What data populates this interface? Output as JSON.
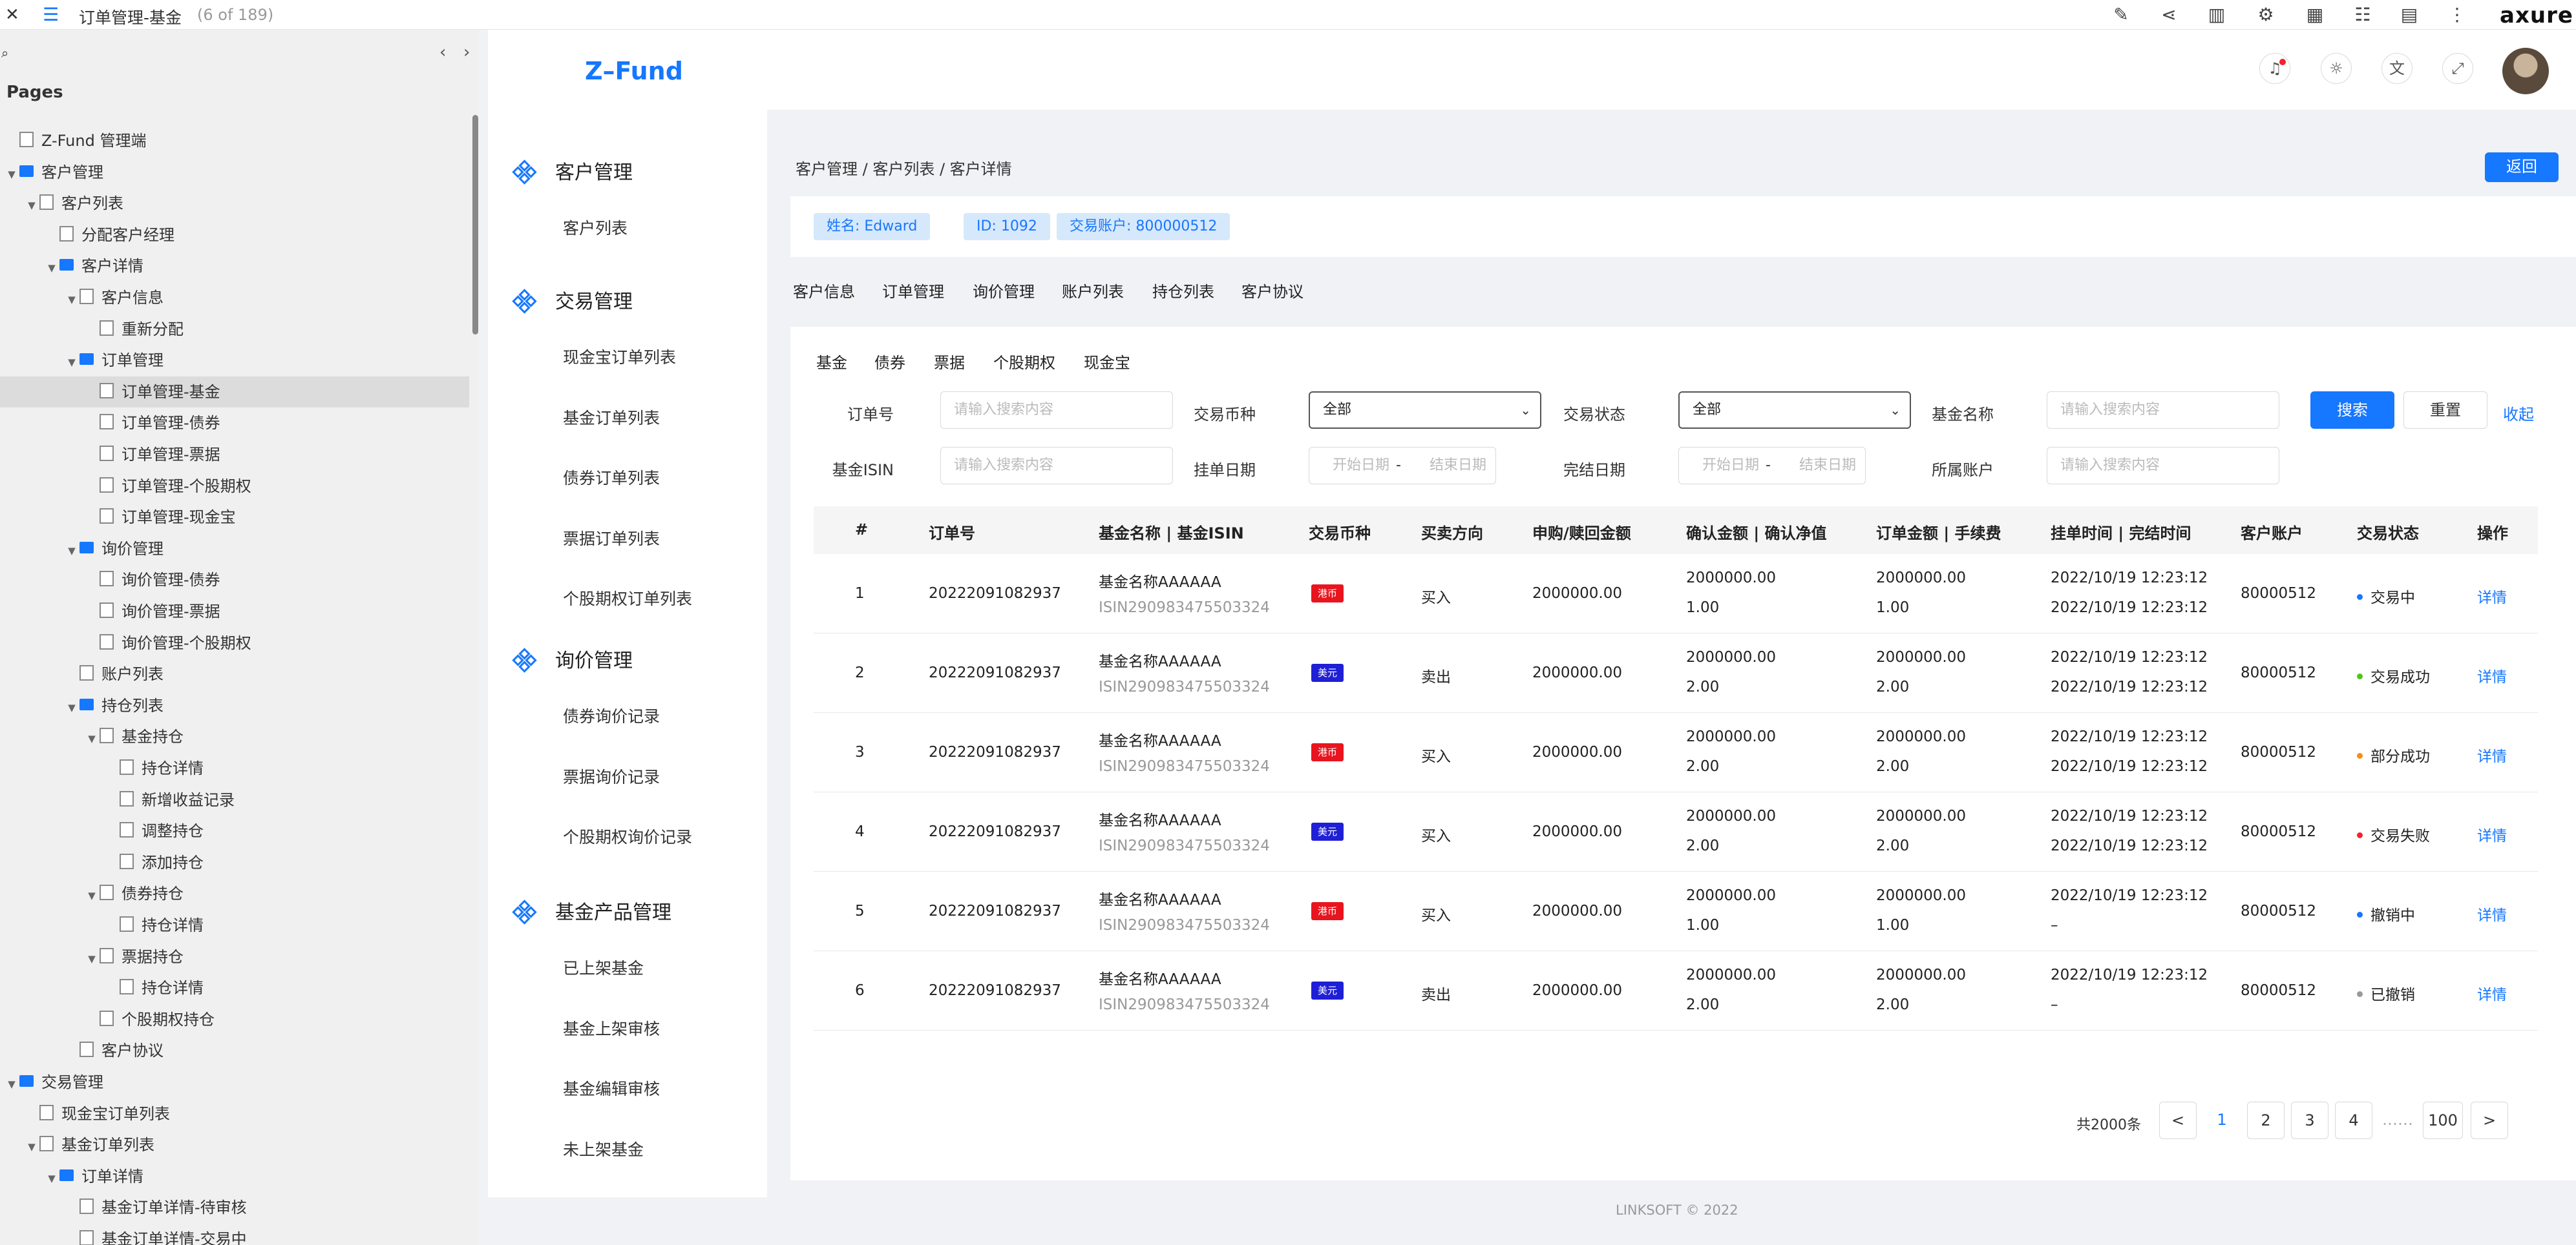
{
  "axure_toolbar": {
    "close": "✕",
    "page_title": "订单管理-基金",
    "page_count": "(6 of 189)",
    "logo": "axure",
    "icons": [
      "edit-icon",
      "share-icon",
      "map-icon",
      "settings-icon",
      "grid-icon",
      "list-icon",
      "notes-icon",
      "more-icon"
    ]
  },
  "pages_panel": {
    "heading": "Pages",
    "items": [
      {
        "label": "Z-Fund 管理端",
        "level": 0,
        "type": "page",
        "caret": ""
      },
      {
        "label": "客户管理",
        "level": 0,
        "type": "folder",
        "caret": "▼"
      },
      {
        "label": "客户列表",
        "level": 1,
        "type": "page",
        "caret": "▼"
      },
      {
        "label": "分配客户经理",
        "level": 2,
        "type": "page",
        "caret": ""
      },
      {
        "label": "客户详情",
        "level": 2,
        "type": "folder",
        "caret": "▼"
      },
      {
        "label": "客户信息",
        "level": 3,
        "type": "page",
        "caret": "▼"
      },
      {
        "label": "重新分配",
        "level": 4,
        "type": "page",
        "caret": ""
      },
      {
        "label": "订单管理",
        "level": 3,
        "type": "folder",
        "caret": "▼"
      },
      {
        "label": "订单管理-基金",
        "level": 4,
        "type": "page",
        "caret": "",
        "selected": true
      },
      {
        "label": "订单管理-债券",
        "level": 4,
        "type": "page",
        "caret": ""
      },
      {
        "label": "订单管理-票据",
        "level": 4,
        "type": "page",
        "caret": ""
      },
      {
        "label": "订单管理-个股期权",
        "level": 4,
        "type": "page",
        "caret": ""
      },
      {
        "label": "订单管理-现金宝",
        "level": 4,
        "type": "page",
        "caret": ""
      },
      {
        "label": "询价管理",
        "level": 3,
        "type": "folder",
        "caret": "▼"
      },
      {
        "label": "询价管理-债券",
        "level": 4,
        "type": "page",
        "caret": ""
      },
      {
        "label": "询价管理-票据",
        "level": 4,
        "type": "page",
        "caret": ""
      },
      {
        "label": "询价管理-个股期权",
        "level": 4,
        "type": "page",
        "caret": ""
      },
      {
        "label": "账户列表",
        "level": 3,
        "type": "page",
        "caret": ""
      },
      {
        "label": "持仓列表",
        "level": 3,
        "type": "folder",
        "caret": "▼"
      },
      {
        "label": "基金持仓",
        "level": 4,
        "type": "page",
        "caret": "▼"
      },
      {
        "label": "持仓详情",
        "level": 5,
        "type": "page",
        "caret": ""
      },
      {
        "label": "新增收益记录",
        "level": 5,
        "type": "page",
        "caret": ""
      },
      {
        "label": "调整持仓",
        "level": 5,
        "type": "page",
        "caret": ""
      },
      {
        "label": "添加持仓",
        "level": 5,
        "type": "page",
        "caret": ""
      },
      {
        "label": "债券持仓",
        "level": 4,
        "type": "page",
        "caret": "▼"
      },
      {
        "label": "持仓详情",
        "level": 5,
        "type": "page",
        "caret": ""
      },
      {
        "label": "票据持仓",
        "level": 4,
        "type": "page",
        "caret": "▼"
      },
      {
        "label": "持仓详情",
        "level": 5,
        "type": "page",
        "caret": ""
      },
      {
        "label": "个股期权持仓",
        "level": 4,
        "type": "page",
        "caret": ""
      },
      {
        "label": "客户协议",
        "level": 3,
        "type": "page",
        "caret": ""
      },
      {
        "label": "交易管理",
        "level": 0,
        "type": "folder",
        "caret": "▼"
      },
      {
        "label": "现金宝订单列表",
        "level": 1,
        "type": "page",
        "caret": ""
      },
      {
        "label": "基金订单列表",
        "level": 1,
        "type": "page",
        "caret": "▼"
      },
      {
        "label": "订单详情",
        "level": 2,
        "type": "folder",
        "caret": "▼"
      },
      {
        "label": "基金订单详情-待审核",
        "level": 3,
        "type": "page",
        "caret": ""
      },
      {
        "label": "基金订单详情-交易中",
        "level": 3,
        "type": "page",
        "caret": ""
      }
    ]
  },
  "app": {
    "brand": "Z–Fund",
    "header_icons": [
      "bell-icon",
      "theme-icon",
      "translate-icon",
      "fullscreen-icon"
    ],
    "menu": [
      {
        "group": "客户管理",
        "items": [
          "客户列表"
        ]
      },
      {
        "group": "交易管理",
        "items": [
          "现金宝订单列表",
          "基金订单列表",
          "债券订单列表",
          "票据订单列表",
          "个股期权订单列表"
        ]
      },
      {
        "group": "询价管理",
        "items": [
          "债券询价记录",
          "票据询价记录",
          "个股期权询价记录"
        ]
      },
      {
        "group": "基金产品管理",
        "items": [
          "已上架基金",
          "基金上架审核",
          "基金编辑审核",
          "未上架基金"
        ]
      }
    ],
    "breadcrumb": "客户管理 / 客户列表 / 客户详情",
    "back_label": "返回",
    "tags": [
      "姓名: Edward",
      "ID: 1092",
      "交易账户: 800000512"
    ],
    "tabs": [
      "客户信息",
      "订单管理",
      "询价管理",
      "账户列表",
      "持仓列表",
      "客户协议"
    ],
    "subtabs": [
      "基金",
      "债券",
      "票据",
      "个股期权",
      "现金宝"
    ],
    "filters": {
      "order_no_label": "订单号",
      "order_no_placeholder": "请输入搜索内容",
      "currency_label": "交易币种",
      "currency_value": "全部",
      "status_label": "交易状态",
      "status_value": "全部",
      "fund_name_label": "基金名称",
      "fund_name_placeholder": "请输入搜索内容",
      "isin_label": "基金ISIN",
      "isin_placeholder": "请输入搜索内容",
      "order_date_label": "挂单日期",
      "start_placeholder": "开始日期",
      "end_placeholder": "结束日期",
      "range_sep": "-",
      "done_date_label": "完结日期",
      "account_label": "所属账户",
      "account_placeholder": "请输入搜索内容",
      "search_label": "搜索",
      "reset_label": "重置",
      "collapse_label": "收起"
    },
    "table": {
      "columns": [
        "#",
        "订单号",
        "基金名称 | 基金ISIN",
        "交易币种",
        "买卖方向",
        "申购/赎回金额",
        "确认金额 | 确认净值",
        "订单金额 | 手续费",
        "挂单时间 | 完结时间",
        "客户账户",
        "交易状态",
        "操作"
      ],
      "rows": [
        {
          "idx": "1",
          "order_no": "20222091082937",
          "fund_name": "基金名称AAAAAA",
          "isin": "ISIN290983475503324",
          "currency": "港币",
          "currency_color": "#e8141e",
          "direction": "买入",
          "amount": "2000000.00",
          "confirm_amount": "2000000.00",
          "confirm_nav": "1.00",
          "order_amount": "2000000.00",
          "fee": "1.00",
          "order_time": "2022/10/19 12:23:12",
          "done_time": "2022/10/19 12:23:12",
          "account": "80000512",
          "status": "交易中",
          "status_color": "#1677ff",
          "action": "详情"
        },
        {
          "idx": "2",
          "order_no": "20222091082937",
          "fund_name": "基金名称AAAAAA",
          "isin": "ISIN290983475503324",
          "currency": "美元",
          "currency_color": "#1f1fd6",
          "direction": "卖出",
          "amount": "2000000.00",
          "confirm_amount": "2000000.00",
          "confirm_nav": "2.00",
          "order_amount": "2000000.00",
          "fee": "2.00",
          "order_time": "2022/10/19 12:23:12",
          "done_time": "2022/10/19 12:23:12",
          "account": "80000512",
          "status": "交易成功",
          "status_color": "#52c41a",
          "action": "详情"
        },
        {
          "idx": "3",
          "order_no": "20222091082937",
          "fund_name": "基金名称AAAAAA",
          "isin": "ISIN290983475503324",
          "currency": "港币",
          "currency_color": "#e8141e",
          "direction": "买入",
          "amount": "2000000.00",
          "confirm_amount": "2000000.00",
          "confirm_nav": "2.00",
          "order_amount": "2000000.00",
          "fee": "2.00",
          "order_time": "2022/10/19 12:23:12",
          "done_time": "2022/10/19 12:23:12",
          "account": "80000512",
          "status": "部分成功",
          "status_color": "#fa8c16",
          "action": "详情"
        },
        {
          "idx": "4",
          "order_no": "20222091082937",
          "fund_name": "基金名称AAAAAA",
          "isin": "ISIN290983475503324",
          "currency": "美元",
          "currency_color": "#1f1fd6",
          "direction": "买入",
          "amount": "2000000.00",
          "confirm_amount": "2000000.00",
          "confirm_nav": "2.00",
          "order_amount": "2000000.00",
          "fee": "2.00",
          "order_time": "2022/10/19 12:23:12",
          "done_time": "2022/10/19 12:23:12",
          "account": "80000512",
          "status": "交易失败",
          "status_color": "#f5222d",
          "action": "详情"
        },
        {
          "idx": "5",
          "order_no": "20222091082937",
          "fund_name": "基金名称AAAAAA",
          "isin": "ISIN290983475503324",
          "currency": "港币",
          "currency_color": "#e8141e",
          "direction": "买入",
          "amount": "2000000.00",
          "confirm_amount": "2000000.00",
          "confirm_nav": "1.00",
          "order_amount": "2000000.00",
          "fee": "1.00",
          "order_time": "2022/10/19 12:23:12",
          "done_time": "–",
          "account": "80000512",
          "status": "撤销中",
          "status_color": "#1677ff",
          "action": "详情"
        },
        {
          "idx": "6",
          "order_no": "20222091082937",
          "fund_name": "基金名称AAAAAA",
          "isin": "ISIN290983475503324",
          "currency": "美元",
          "currency_color": "#1f1fd6",
          "direction": "卖出",
          "amount": "2000000.00",
          "confirm_amount": "2000000.00",
          "confirm_nav": "2.00",
          "order_amount": "2000000.00",
          "fee": "2.00",
          "order_time": "2022/10/19 12:23:12",
          "done_time": "–",
          "account": "80000512",
          "status": "已撤销",
          "status_color": "#999999",
          "action": "详情"
        }
      ]
    },
    "pagination": {
      "total": "共2000条",
      "prev": "<",
      "pages": [
        "1",
        "2",
        "3",
        "4"
      ],
      "ellipsis": "……",
      "last": "100",
      "next": ">",
      "current": "1"
    },
    "footer": "LINKSOFT © 2022"
  }
}
